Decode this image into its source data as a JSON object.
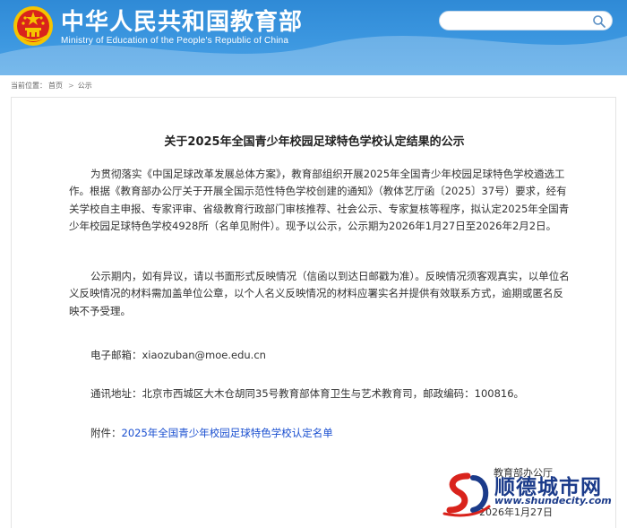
{
  "header": {
    "site_name_cn": "中华人民共和国教育部",
    "site_name_en": "Ministry of Education of the People's Republic of China",
    "search_placeholder": ""
  },
  "breadcrumb": {
    "prefix": "当前位置：",
    "items": [
      "首页",
      "公示"
    ]
  },
  "article": {
    "title": "关于2025年全国青少年校园足球特色学校认定结果的公示",
    "paragraphs": [
      "为贯彻落实《中国足球改革发展总体方案》，教育部组织开展2025年全国青少年校园足球特色学校遴选工作。根据《教育部办公厅关于开展全国示范性特色学校创建的通知》（教体艺厅函〔2025〕37号）要求，经有关学校自主申报、专家评审、省级教育行政部门审核推荐、社会公示、专家复核等程序，拟认定2025年全国青少年校园足球特色学校4928所（名单见附件）。现予以公示，公示期为2026年1月27日至2026年2月2日。",
      "公示期内，如有异议，请以书面形式反映情况（信函以到达日邮戳为准）。反映情况须客观真实，以单位名义反映情况的材料需加盖单位公章，以个人名义反映情况的材料应署实名并提供有效联系方式，逾期或匿名反映不予受理。"
    ],
    "email_label": "电子邮箱：",
    "email_value": "xiaozuban@moe.edu.cn",
    "address_label": "通讯地址：",
    "address_value": "北京市西城区大木仓胡同35号教育部体育卫生与艺术教育司，邮政编码：100816。",
    "attachment_label": "附件：",
    "attachment_link": "2025年全国青少年校园足球特色学校认定名单",
    "signature_org": "教育部办公厅",
    "signature_date": "2026年1月27日"
  },
  "watermark": {
    "brand": "顺德城市网",
    "url": "www.shundecity.com"
  },
  "colors": {
    "header_blue": "#3a92dd",
    "link_blue": "#1a4fd0",
    "emblem_red": "#d9231c",
    "emblem_gold": "#f5c400"
  }
}
